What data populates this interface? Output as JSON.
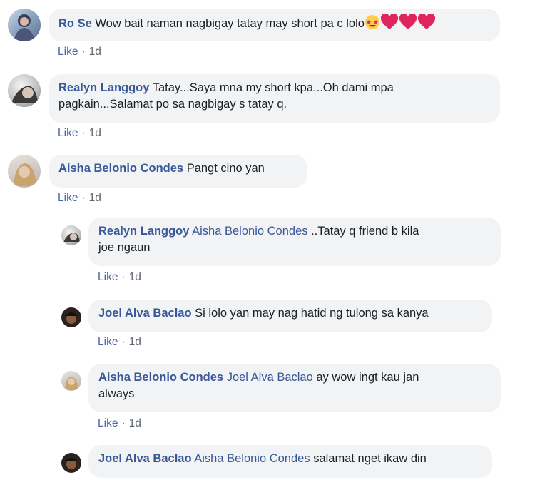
{
  "comments": [
    {
      "author": "Ro Se",
      "text": "Wow bait naman nagbigay tatay may short pa c lolo",
      "like": "Like",
      "time": "1d"
    },
    {
      "author": "Realyn Langgoy",
      "text_line1": "Tatay...Saya mna my short kpa...Oh dami mpa",
      "text_line2": "pagkain...Salamat po sa nagbigay s tatay q.",
      "like": "Like",
      "time": "1d"
    },
    {
      "author": "Aisha Belonio Condes",
      "text": "Pangt cino yan",
      "like": "Like",
      "time": "1d"
    }
  ],
  "replies": [
    {
      "author": "Realyn Langgoy",
      "mention": "Aisha Belonio Condes",
      "text_line1": "..Tatay q friend b kila",
      "text_line2": "joe ngaun",
      "like": "Like",
      "time": "1d"
    },
    {
      "author": "Joel Alva Baclao",
      "text": "Si lolo yan may nag hatid ng tulong sa kanya",
      "like": "Like",
      "time": "1d"
    },
    {
      "author": "Aisha Belonio Condes",
      "mention": "Joel Alva Baclao",
      "text_line1": "ay wow ingt kau jan",
      "text_line2": "always",
      "like": "Like",
      "time": "1d"
    },
    {
      "author": "Joel Alva Baclao",
      "mention": "Aisha Belonio Condes",
      "text": "salamat nget ikaw din"
    }
  ],
  "colors": {
    "name": "#385898",
    "bubble": "#f2f3f5",
    "meta": "#606770",
    "heart": "#e0245e"
  }
}
